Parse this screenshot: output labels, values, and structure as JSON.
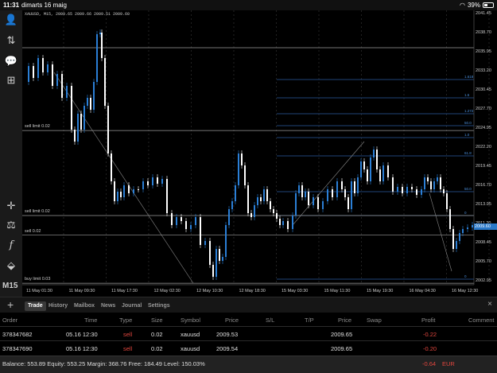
{
  "status": {
    "time": "11:31",
    "date": "dimarts 16 maig",
    "battery": "39%"
  },
  "chart": {
    "symbol_info": "XAUUSD, M15, 2009.65 2009.66 2009.51 2009.60",
    "timeframe": "M15",
    "current_price": "2009.60",
    "order_lines": [
      {
        "label": "sell limit 0.02",
        "price": 2024.59
      },
      {
        "label": "sell limit 0.02",
        "price": 2012.35
      },
      {
        "label": "sell 0.02",
        "price": 2009.53
      },
      {
        "label": "buy limit 0.03",
        "price": 2002.59
      }
    ],
    "price_axis": [
      "2041.45",
      "2038.70",
      "2035.95",
      "2033.20",
      "2030.45",
      "2027.70",
      "2024.95",
      "2022.20",
      "2019.45",
      "2016.70",
      "2013.95",
      "2011.20",
      "2008.45",
      "2005.70",
      "2002.95"
    ],
    "fib_labels": [
      "1.618",
      "1.5",
      "1.272",
      "50.0",
      "1.0",
      "61.8",
      "50.0",
      "0",
      "0"
    ],
    "time_axis": [
      "11 May 01:30",
      "11 May 09:30",
      "11 May 17:30",
      "12 May 02:30",
      "12 May 10:30",
      "12 May 18:30",
      "15 May 03:30",
      "15 May 11:30",
      "15 May 19:30",
      "16 May 04:30",
      "16 May 12:30"
    ],
    "colors": {
      "bull": "#2b7fd6",
      "bear": "#ffffff",
      "fib": "#2c5aa0",
      "order": "#9a9a9a"
    }
  },
  "tabs": {
    "items": [
      "Trade",
      "History",
      "Mailbox",
      "News",
      "Journal",
      "Settings"
    ],
    "active": "Trade"
  },
  "table": {
    "headers": [
      "Order",
      "Time",
      "Type",
      "Size",
      "Symbol",
      "Price",
      "S/L",
      "T/P",
      "Price",
      "Swap",
      "Profit",
      "Comment"
    ],
    "rows": [
      {
        "order": "378347682",
        "time": "05.16 12:30",
        "type": "sell",
        "size": "0.02",
        "symbol": "xauusd",
        "price": "2009.53",
        "price2": "2009.65",
        "profit": "-0.22"
      },
      {
        "order": "378347690",
        "time": "05.16 12:30",
        "type": "sell",
        "size": "0.02",
        "symbol": "xauusd",
        "price": "2009.54",
        "price2": "2009.65",
        "profit": "-0.20"
      }
    ]
  },
  "balance": {
    "text": "Balance: 553.89 Equity: 553.25 Margin: 368.76 Free: 184.49 Level: 150.03%",
    "total": "-0.64",
    "currency": "EUR"
  }
}
